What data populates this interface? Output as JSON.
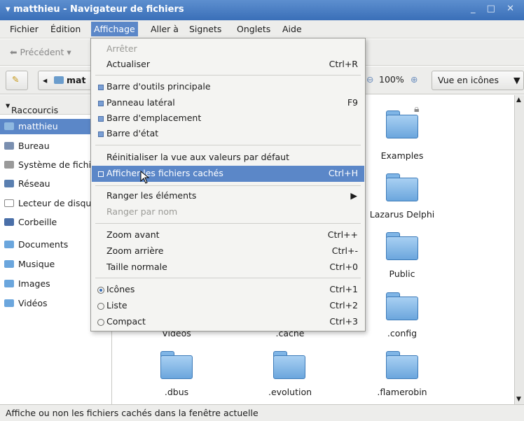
{
  "window": {
    "title": "matthieu - Navigateur de fichiers",
    "controls": "_ □ ✕"
  },
  "menubar": [
    "Fichier",
    "Édition",
    "Affichage",
    "Aller à",
    "Signets",
    "Onglets",
    "Aide"
  ],
  "toolbar": {
    "back_label": "Précédent",
    "location_label": "mat",
    "zoom": "100%",
    "view_mode": "Vue en icônes"
  },
  "sidebar": {
    "header": "Raccourcis",
    "items": [
      {
        "label": "matthieu",
        "color": "#6a9ccc"
      },
      {
        "label": "Bureau",
        "color": "#7a8fb0"
      },
      {
        "label": "Système de fichiers",
        "color": "#9a9a9a"
      },
      {
        "label": "Réseau",
        "color": "#5a7fb0"
      },
      {
        "label": "Lecteur de disquettes",
        "color": "#888888"
      },
      {
        "label": "Corbeille",
        "color": "#4a6fa8"
      },
      {
        "label": "Documents",
        "color": "#6ba6dd"
      },
      {
        "label": "Musique",
        "color": "#6ba6dd"
      },
      {
        "label": "Images",
        "color": "#6ba6dd"
      },
      {
        "label": "Vidéos",
        "color": "#6ba6dd"
      }
    ]
  },
  "files": [
    "Examples",
    "Lazarus Delphi",
    "Public",
    "Vidéos",
    ".cache",
    ".config",
    ".dbus",
    ".evolution",
    ".flamerobin"
  ],
  "menu": {
    "stop": "Arrêter",
    "reload": "Actualiser",
    "reload_sc": "Ctrl+R",
    "main_toolbar": "Barre d'outils principale",
    "side_pane": "Panneau latéral",
    "side_pane_sc": "F9",
    "location_bar": "Barre d'emplacement",
    "status_bar": "Barre d'état",
    "reset_view": "Réinitialiser la vue aux valeurs par défaut",
    "show_hidden": "Afficher les fichiers cachés",
    "show_hidden_sc": "Ctrl+H",
    "arrange": "Ranger les éléments",
    "arrange_name": "Ranger par nom",
    "zoom_in": "Zoom avant",
    "zoom_in_sc": "Ctrl++",
    "zoom_out": "Zoom arrière",
    "zoom_out_sc": "Ctrl+-",
    "normal_size": "Taille normale",
    "normal_size_sc": "Ctrl+0",
    "icons": "Icônes",
    "icons_sc": "Ctrl+1",
    "list": "Liste",
    "list_sc": "Ctrl+2",
    "compact": "Compact",
    "compact_sc": "Ctrl+3"
  },
  "status": "Affiche ou non les fichiers cachés dans la fenêtre actuelle"
}
